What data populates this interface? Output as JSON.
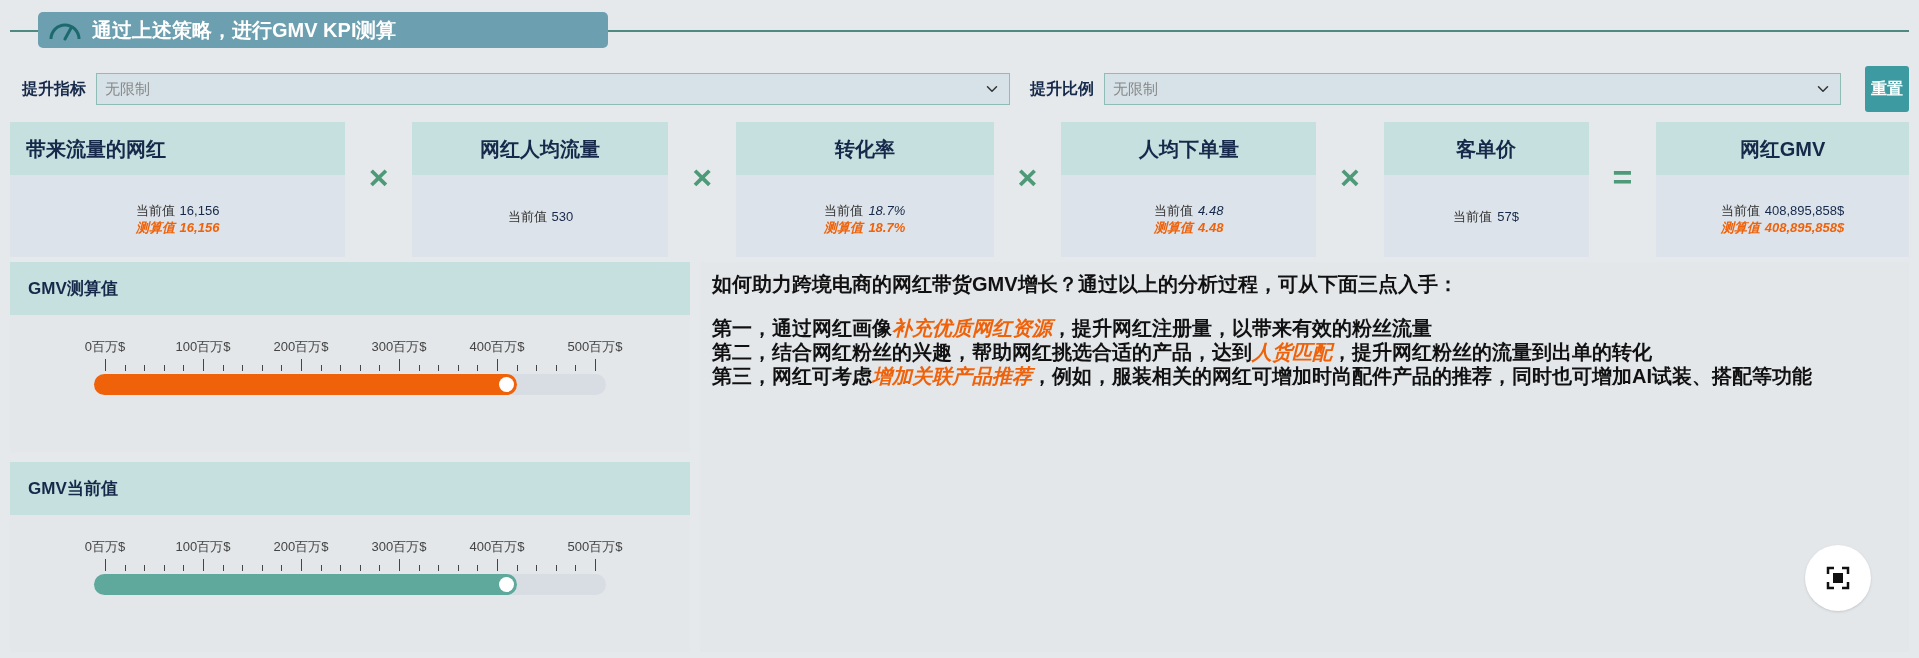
{
  "header": {
    "title": "通过上述策略，进行GMV KPI测算"
  },
  "filters": [
    {
      "label": "提升指标",
      "placeholder": "无限制"
    },
    {
      "label": "提升比例",
      "placeholder": "无限制"
    }
  ],
  "reset_button": "重置",
  "metrics": [
    {
      "title": "带来流量的网红",
      "current_label": "当前值",
      "current_value": "16,156",
      "current_italic": false,
      "estimate_label": "测算值",
      "estimate_value": "16,156",
      "operator": "×"
    },
    {
      "title": "网红人均流量",
      "current_label": "当前值",
      "current_value": "530",
      "current_italic": false,
      "operator": "×"
    },
    {
      "title": "转化率",
      "current_label": "当前值",
      "current_value": "18.7%",
      "current_italic": true,
      "estimate_label": "测算值",
      "estimate_value": "18.7%",
      "operator": "×"
    },
    {
      "title": "人均下单量",
      "current_label": "当前值",
      "current_value": "4.48",
      "current_italic": true,
      "estimate_label": "测算值",
      "estimate_value": "4.48",
      "operator": "×"
    },
    {
      "title": "客单价",
      "current_label": "当前值",
      "current_value": "57$",
      "current_italic": false,
      "operator": "="
    },
    {
      "title": "网红GMV",
      "current_label": "当前值",
      "current_value": "408,895,858$",
      "current_italic": false,
      "estimate_label": "测算值",
      "estimate_value": "408,895,858$"
    }
  ],
  "gauges": [
    {
      "title": "GMV测算值",
      "ticks": [
        "0百万$",
        "100百万$",
        "200百万$",
        "300百万$",
        "400百万$",
        "500百万$"
      ],
      "level": 0.818,
      "color": "#f0620a"
    },
    {
      "title": "GMV当前值",
      "ticks": [
        "0百万$",
        "100百万$",
        "200百万$",
        "300百万$",
        "400百万$",
        "500百万$"
      ],
      "level": 0.818,
      "color": "#5fa89c"
    }
  ],
  "insight": {
    "question": "如何助力跨境电商的网红带货GMV增长？通过以上的分析过程，可从下面三点入手：",
    "points": [
      "第一，通过网红画像**补充优质网红资源**，提升网红注册量，以带来有效的粉丝流量",
      "第二，结合网红粉丝的兴趣，帮助网红挑选合适的产品，达到**人货匹配**，提升网红粉丝的流量到出单的转化",
      "第三，网红可考虑**增加关联产品推荐**，例如，服装相关的网红可增加时尚配件产品的推荐，同时也可增加AI试装、搭配等功能"
    ]
  }
}
